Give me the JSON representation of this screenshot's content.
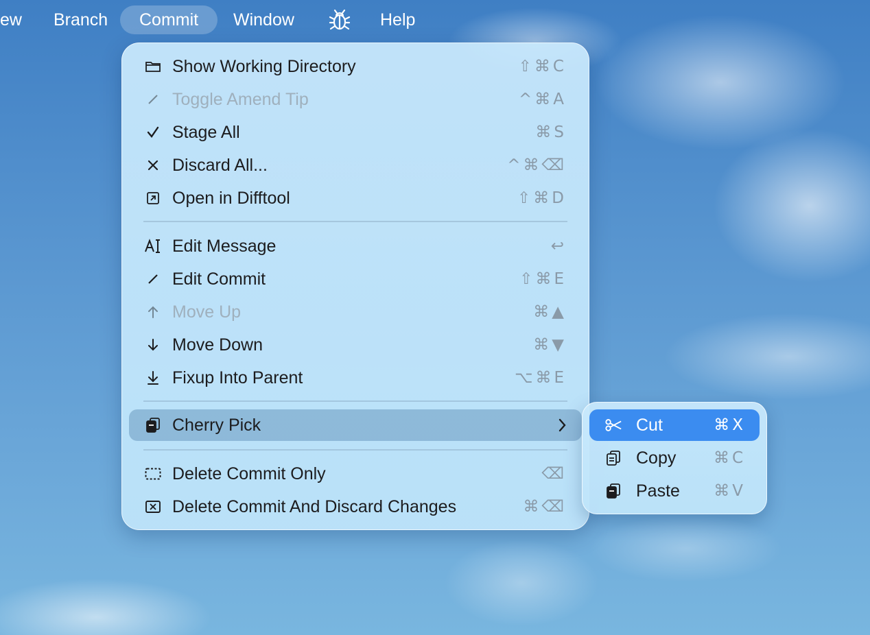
{
  "menubar": {
    "items": [
      {
        "label": "ew"
      },
      {
        "label": "Branch"
      },
      {
        "label": "Commit"
      },
      {
        "label": "Window"
      },
      {
        "label": "Help"
      }
    ],
    "bug_icon": "bug-icon"
  },
  "menu": {
    "items": [
      {
        "label": "Show Working Directory",
        "shortcut": "⇧⌘C",
        "icon": "folder-icon",
        "enabled": true
      },
      {
        "label": "Toggle Amend Tip",
        "shortcut": "^⌘A",
        "icon": "pencil-icon",
        "enabled": false
      },
      {
        "label": "Stage All",
        "shortcut": "⌘S",
        "icon": "checkmark-icon",
        "enabled": true
      },
      {
        "label": "Discard All...",
        "shortcut": "^⌘⌫",
        "icon": "x-icon",
        "enabled": true
      },
      {
        "label": "Open in Difftool",
        "shortcut": "⇧⌘D",
        "icon": "external-box-icon",
        "enabled": true
      },
      {
        "label": "Edit Message",
        "shortcut": "↩",
        "icon": "text-cursor-icon",
        "enabled": true
      },
      {
        "label": "Edit Commit",
        "shortcut": "⇧⌘E",
        "icon": "pencil-icon",
        "enabled": true
      },
      {
        "label": "Move Up",
        "shortcut": "⌘▲",
        "icon": "arrow-up-icon",
        "enabled": false
      },
      {
        "label": "Move Down",
        "shortcut": "⌘▼",
        "icon": "arrow-down-icon",
        "enabled": true
      },
      {
        "label": "Fixup Into Parent",
        "shortcut": "⌥⌘E",
        "icon": "arrow-down-to-line-icon",
        "enabled": true
      },
      {
        "label": "Cherry Pick",
        "shortcut": "",
        "icon": "clipboard-icon",
        "enabled": true,
        "highlighted": true,
        "has_submenu": true
      },
      {
        "label": "Delete Commit Only",
        "shortcut": "⌫",
        "icon": "dashed-rect-icon",
        "enabled": true
      },
      {
        "label": "Delete Commit And Discard Changes",
        "shortcut": "⌘⌫",
        "icon": "x-box-icon",
        "enabled": true
      }
    ]
  },
  "submenu": {
    "items": [
      {
        "label": "Cut",
        "shortcut": "⌘X",
        "icon": "scissors-icon",
        "selected": true
      },
      {
        "label": "Copy",
        "shortcut": "⌘C",
        "icon": "copy-icon"
      },
      {
        "label": "Paste",
        "shortcut": "⌘V",
        "icon": "paste-icon"
      }
    ]
  },
  "colors": {
    "selection": "#3b8cf0",
    "menu_bg": "#c8e8fc"
  }
}
